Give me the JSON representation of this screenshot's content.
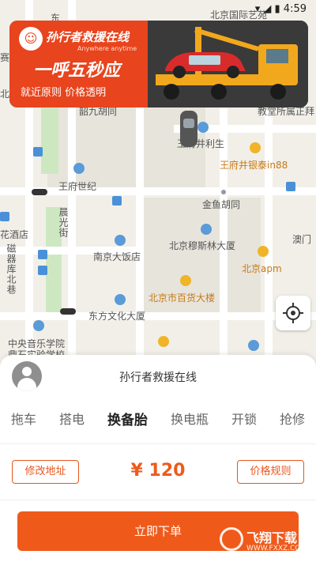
{
  "status_bar": {
    "time": "4:59"
  },
  "banner": {
    "brand": "孙行者救援在线",
    "brand_sub": "Anywhere anytime",
    "mascot_tag": "一呼五秒应",
    "slogan": "一呼五秒应",
    "tags": "就近原则  价格透明"
  },
  "map_labels": [
    "北京国际艺苑",
    "东",
    "赛",
    "北",
    "韶九胡同",
    "教堂所属正拜",
    "王府井利生",
    "王府井银泰in88",
    "王府世纪",
    "金鱼胡同",
    "晨光街",
    "花酒店",
    "磁器库北巷",
    "南京大饭店",
    "北京穆斯林大厦",
    "澳门",
    "北京apm",
    "北京市百货大楼",
    "东方文化大厦",
    "中央音乐学院",
    "鼎石实验学校"
  ],
  "sheet": {
    "title": "孙行者救援在线",
    "tabs": [
      "拖车",
      "搭电",
      "换备胎",
      "换电瓶",
      "开锁",
      "抢修"
    ],
    "active_tab": 2,
    "modify_address": "修改地址",
    "price": "¥ 120",
    "price_rules": "价格规则",
    "order_button": "立即下单"
  },
  "watermark": {
    "text": "飞翔下载",
    "url": "WWW.FXXZ.COM"
  },
  "colors": {
    "accent": "#ef5a1b",
    "banner_red": "#e8441d"
  }
}
